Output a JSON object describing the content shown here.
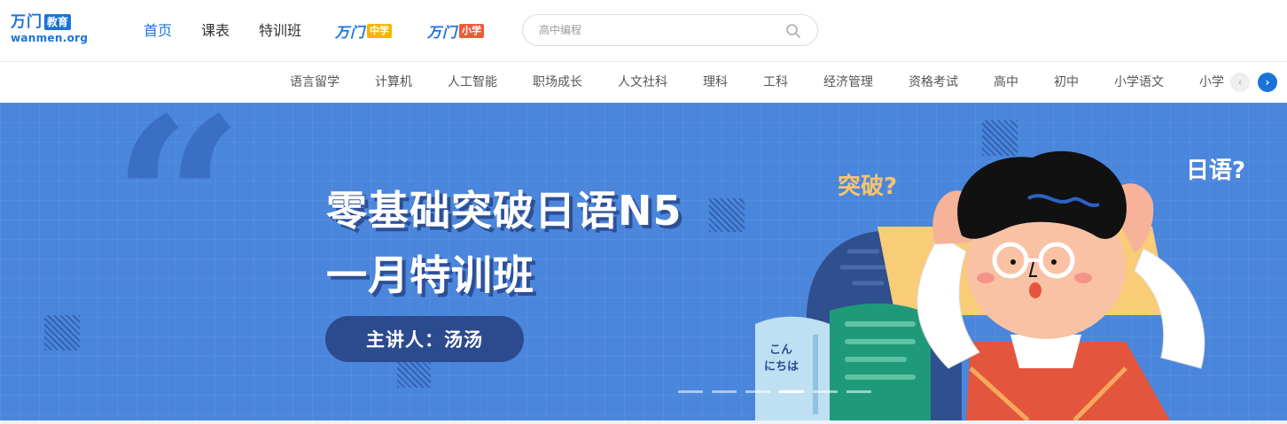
{
  "header": {
    "logo": {
      "cn": "万门",
      "edu": "教育",
      "en": "wanmen.org"
    },
    "nav": [
      "首页",
      "课表",
      "特训班"
    ],
    "middle_school": {
      "brand": "万门",
      "tag": "中学"
    },
    "primary_school": {
      "brand": "万门",
      "tag": "小学"
    },
    "search": {
      "placeholder": "高中编程"
    }
  },
  "categories": [
    "语言留学",
    "计算机",
    "人工智能",
    "职场成长",
    "人文社科",
    "理科",
    "工科",
    "经济管理",
    "资格考试",
    "高中",
    "初中",
    "小学语文",
    "小学"
  ],
  "banner": {
    "title_line1": "零基础突破日语N5",
    "title_line2": "一月特训班",
    "lecturer": "主讲人：汤汤",
    "bubble_left": "突破?",
    "bubble_right": "日语?",
    "book_text_1": "こん",
    "book_text_2": "にちは",
    "slides": 6,
    "active_slide": 4
  },
  "colors": {
    "accent": "#1a73d9",
    "banner_bg": "#4a86db",
    "middle_tag": "#f7b500",
    "primary_tag": "#f05a3c"
  }
}
